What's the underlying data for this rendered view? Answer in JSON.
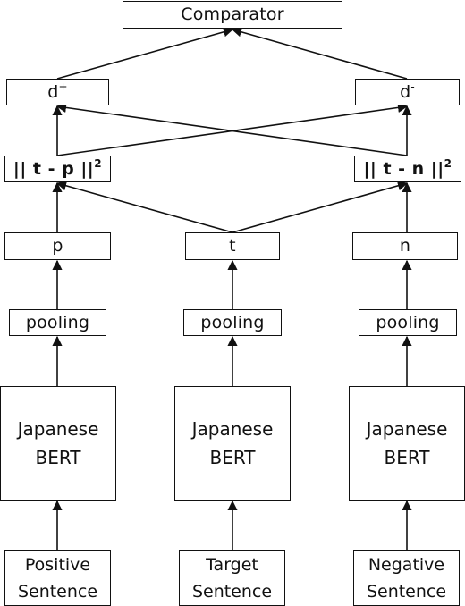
{
  "diagram": {
    "top": {
      "label": "Comparator"
    },
    "distances": {
      "positive": {
        "base": "d",
        "sup": "+"
      },
      "negative": {
        "base": "d",
        "sup": "-"
      }
    },
    "norms": {
      "positive": {
        "expr": "|| t - p ||",
        "sup": "2"
      },
      "negative": {
        "expr": "|| t - n ||",
        "sup": "2"
      }
    },
    "branches": [
      {
        "id": "positive",
        "embedding": "p",
        "pooling": "pooling",
        "encoder": [
          "Japanese",
          "BERT"
        ],
        "input": [
          "Positive",
          "Sentence"
        ]
      },
      {
        "id": "target",
        "embedding": "t",
        "pooling": "pooling",
        "encoder": [
          "Japanese",
          "BERT"
        ],
        "input": [
          "Target",
          "Sentence"
        ]
      },
      {
        "id": "negative",
        "embedding": "n",
        "pooling": "pooling",
        "encoder": [
          "Japanese",
          "BERT"
        ],
        "input": [
          "Negative",
          "Sentence"
        ]
      }
    ],
    "edges": [
      {
        "from": "positive-sentence",
        "to": "positive-bert"
      },
      {
        "from": "target-sentence",
        "to": "target-bert"
      },
      {
        "from": "negative-sentence",
        "to": "negative-bert"
      },
      {
        "from": "positive-bert",
        "to": "positive-pooling"
      },
      {
        "from": "target-bert",
        "to": "target-pooling"
      },
      {
        "from": "negative-bert",
        "to": "negative-pooling"
      },
      {
        "from": "positive-pooling",
        "to": "p"
      },
      {
        "from": "target-pooling",
        "to": "t"
      },
      {
        "from": "negative-pooling",
        "to": "n"
      },
      {
        "from": "p",
        "to": "norm-tp"
      },
      {
        "from": "t",
        "to": "norm-tp"
      },
      {
        "from": "t",
        "to": "norm-tn"
      },
      {
        "from": "n",
        "to": "norm-tn"
      },
      {
        "from": "norm-tp",
        "to": "d-plus"
      },
      {
        "from": "norm-tp",
        "to": "d-minus"
      },
      {
        "from": "norm-tn",
        "to": "d-plus"
      },
      {
        "from": "norm-tn",
        "to": "d-minus"
      },
      {
        "from": "d-plus",
        "to": "comparator"
      },
      {
        "from": "d-minus",
        "to": "comparator"
      }
    ]
  }
}
